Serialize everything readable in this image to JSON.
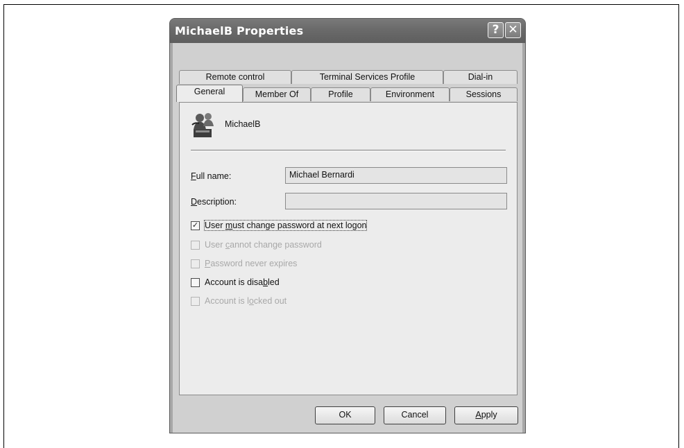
{
  "window": {
    "title": "MichaelB Properties",
    "help_glyph": "?",
    "close_glyph": "✕"
  },
  "tabs_back_row": [
    "Remote control",
    "Terminal Services Profile",
    "Dial-in"
  ],
  "tabs_front_row": [
    "General",
    "Member Of",
    "Profile",
    "Environment",
    "Sessions"
  ],
  "general": {
    "user_name": "MichaelB",
    "full_name_label": {
      "pre": "",
      "key": "F",
      "post": "ull name:"
    },
    "full_name_value": "Michael Bernardi",
    "description_label": {
      "pre": "",
      "key": "D",
      "post": "escription:"
    },
    "description_value": ""
  },
  "options": [
    {
      "pre": "User ",
      "key": "m",
      "post": "ust change password at next logon",
      "checked": "✓"
    },
    {
      "pre": "User ",
      "key": "c",
      "post": "annot change password",
      "checked": ""
    },
    {
      "pre": "",
      "key": "P",
      "post": "assword never expires",
      "checked": ""
    },
    {
      "pre": "Account is disa",
      "key": "b",
      "post": "led",
      "checked": ""
    },
    {
      "pre": "Account is l",
      "key": "o",
      "post": "cked out",
      "checked": ""
    }
  ],
  "buttons": {
    "ok": "OK",
    "cancel": "Cancel",
    "apply": {
      "pre": "",
      "key": "A",
      "post": "pply"
    }
  }
}
